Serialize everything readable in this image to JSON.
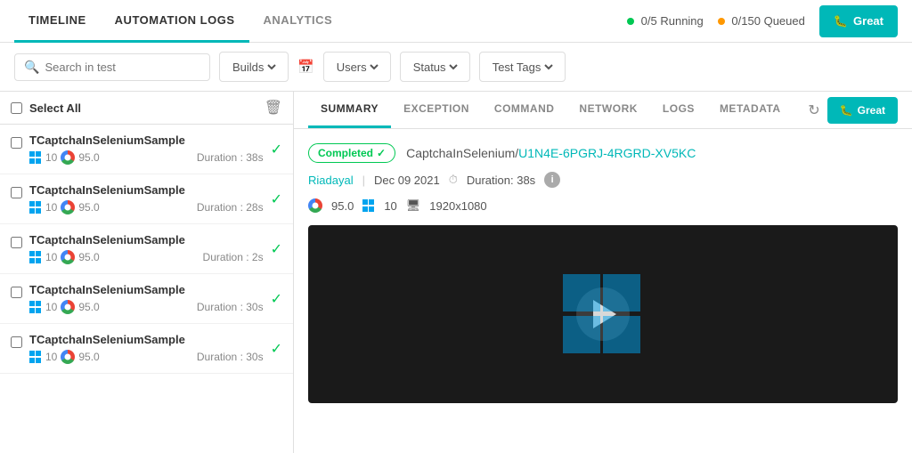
{
  "nav": {
    "tabs": [
      {
        "label": "TIMELINE",
        "active": false
      },
      {
        "label": "AUTOMATION LOGS",
        "active": true
      },
      {
        "label": "ANALYTICS",
        "active": false
      }
    ],
    "running": "0/5",
    "running_label": "Running",
    "queued": "0/150",
    "queued_label": "Queued",
    "create_btn": "Great"
  },
  "filters": {
    "search_placeholder": "Search in test",
    "builds_label": "Builds",
    "users_label": "Users",
    "status_label": "Status",
    "test_tags_label": "Test Tags"
  },
  "list": {
    "select_all": "Select All",
    "items": [
      {
        "name": "TCaptchaInSeleniumSample",
        "os": "10",
        "browser": "95.0",
        "duration": "38s",
        "status": "pass"
      },
      {
        "name": "TCaptchaInSeleniumSample",
        "os": "10",
        "browser": "95.0",
        "duration": "28s",
        "status": "pass"
      },
      {
        "name": "TCaptchaInSeleniumSample",
        "os": "10",
        "browser": "95.0",
        "duration": "2s",
        "status": "pass"
      },
      {
        "name": "TCaptchaInSeleniumSample",
        "os": "10",
        "browser": "95.0",
        "duration": "30s",
        "status": "pass"
      },
      {
        "name": "TCaptchaInSeleniumSample",
        "os": "10",
        "browser": "95.0",
        "duration": "30s",
        "status": "pass"
      }
    ]
  },
  "detail": {
    "tabs": [
      {
        "label": "SUMMARY",
        "active": true
      },
      {
        "label": "EXCEPTION",
        "active": false
      },
      {
        "label": "COMMAND",
        "active": false
      },
      {
        "label": "NETWORK",
        "active": false
      },
      {
        "label": "LOGS",
        "active": false
      },
      {
        "label": "METADATA",
        "active": false
      }
    ],
    "create_btn": "Great",
    "status": "Completed",
    "test_prefix": "CaptchaInSelenium/",
    "test_id": "U1N4E-6PGRJ-4RGRD-XV5KC",
    "user": "Riadayal",
    "date": "Dec 09 2021",
    "duration_label": "Duration: 38s",
    "browser_version": "95.0",
    "os_version": "10",
    "resolution": "1920x1080"
  }
}
